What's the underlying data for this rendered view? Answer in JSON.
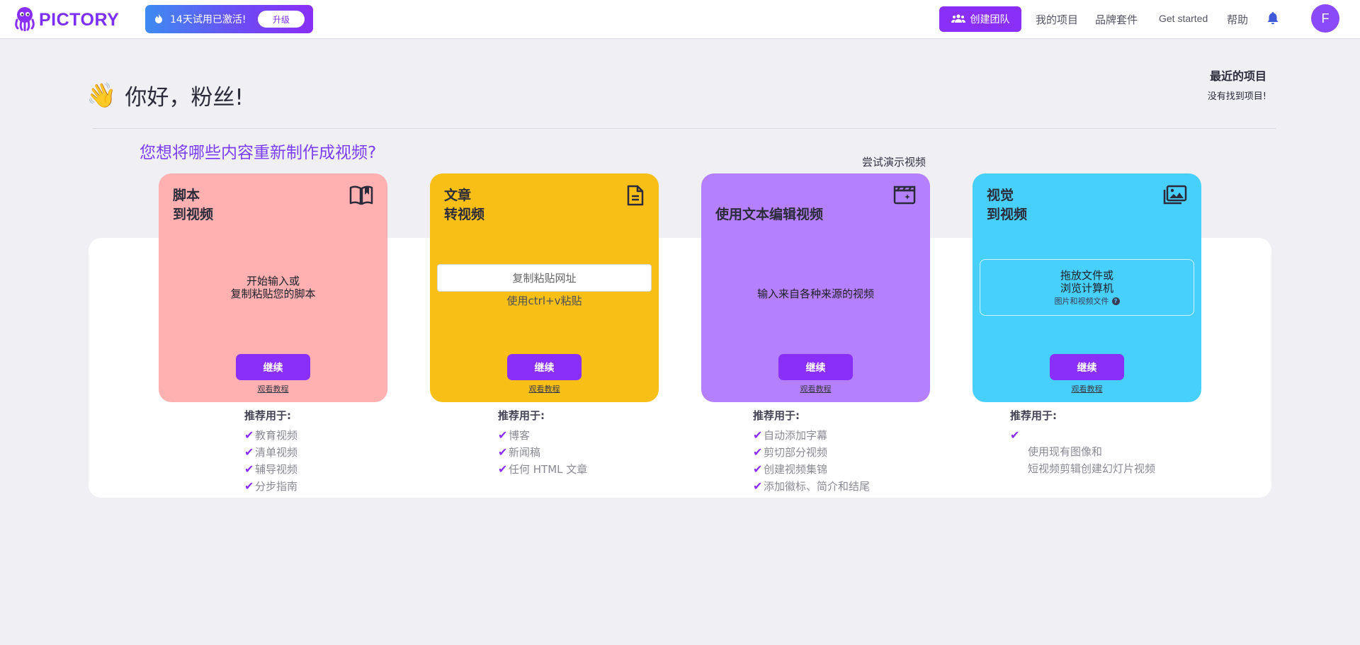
{
  "header": {
    "logo_text": "PICTORY",
    "trial_text": "14天试用已激活!",
    "upgrade_label": "升级",
    "create_team_label": "创建团队",
    "nav": [
      "我的项目",
      "品牌套件",
      "Get started",
      "帮助"
    ],
    "avatar_letter": "F"
  },
  "greeting": {
    "emoji": "👋",
    "text": "你好，粉丝!"
  },
  "recent": {
    "title": "最近的项目",
    "empty": "没有找到项目!"
  },
  "question": "您想将哪些内容重新制作成视频?",
  "demo_link": "尝试演示视频",
  "cards": [
    {
      "title": "脚本\n到视频",
      "icon": "book-open-icon",
      "body": "开始输入或\n复制粘贴您的脚本",
      "continue": "继续",
      "tutorial": "观看教程",
      "color": "#ffb0b0"
    },
    {
      "title": "文章\n转视频",
      "icon": "document-icon",
      "url_placeholder": "复制粘贴网址",
      "paste_hint": "使用ctrl+v粘贴",
      "continue": "继续",
      "tutorial": "观看教程",
      "color": "#f8bf17"
    },
    {
      "title": "使用文本编辑视频",
      "icon": "clapperboard-icon",
      "body": "输入来自各种来源的视频",
      "continue": "继续",
      "tutorial": "观看教程",
      "color": "#b580fe"
    },
    {
      "title": "视觉\n到视频",
      "icon": "images-icon",
      "drop_main": "拖放文件或\n浏览计算机",
      "drop_sub": "图片和视频文件",
      "continue": "继续",
      "tutorial": "观看教程",
      "color": "#47d0fc"
    }
  ],
  "recommendations": [
    {
      "title": "推荐用于:",
      "items": [
        "教育视频",
        "清单视频",
        "辅导视频",
        "分步指南"
      ]
    },
    {
      "title": "推荐用于:",
      "items": [
        "博客",
        "新闻稿",
        "任何 HTML 文章"
      ]
    },
    {
      "title": "推荐用于:",
      "items": [
        "自动添加字幕",
        "剪切部分视频",
        "创建视频集锦",
        "添加徽标、简介和结尾"
      ]
    },
    {
      "title": "推荐用于:",
      "items": [
        ""
      ],
      "description": "使用现有图像和\n短视频剪辑创建幻灯片视频"
    }
  ],
  "colors": {
    "accent": "#8a2ff7",
    "question": "#7b3ff1"
  }
}
